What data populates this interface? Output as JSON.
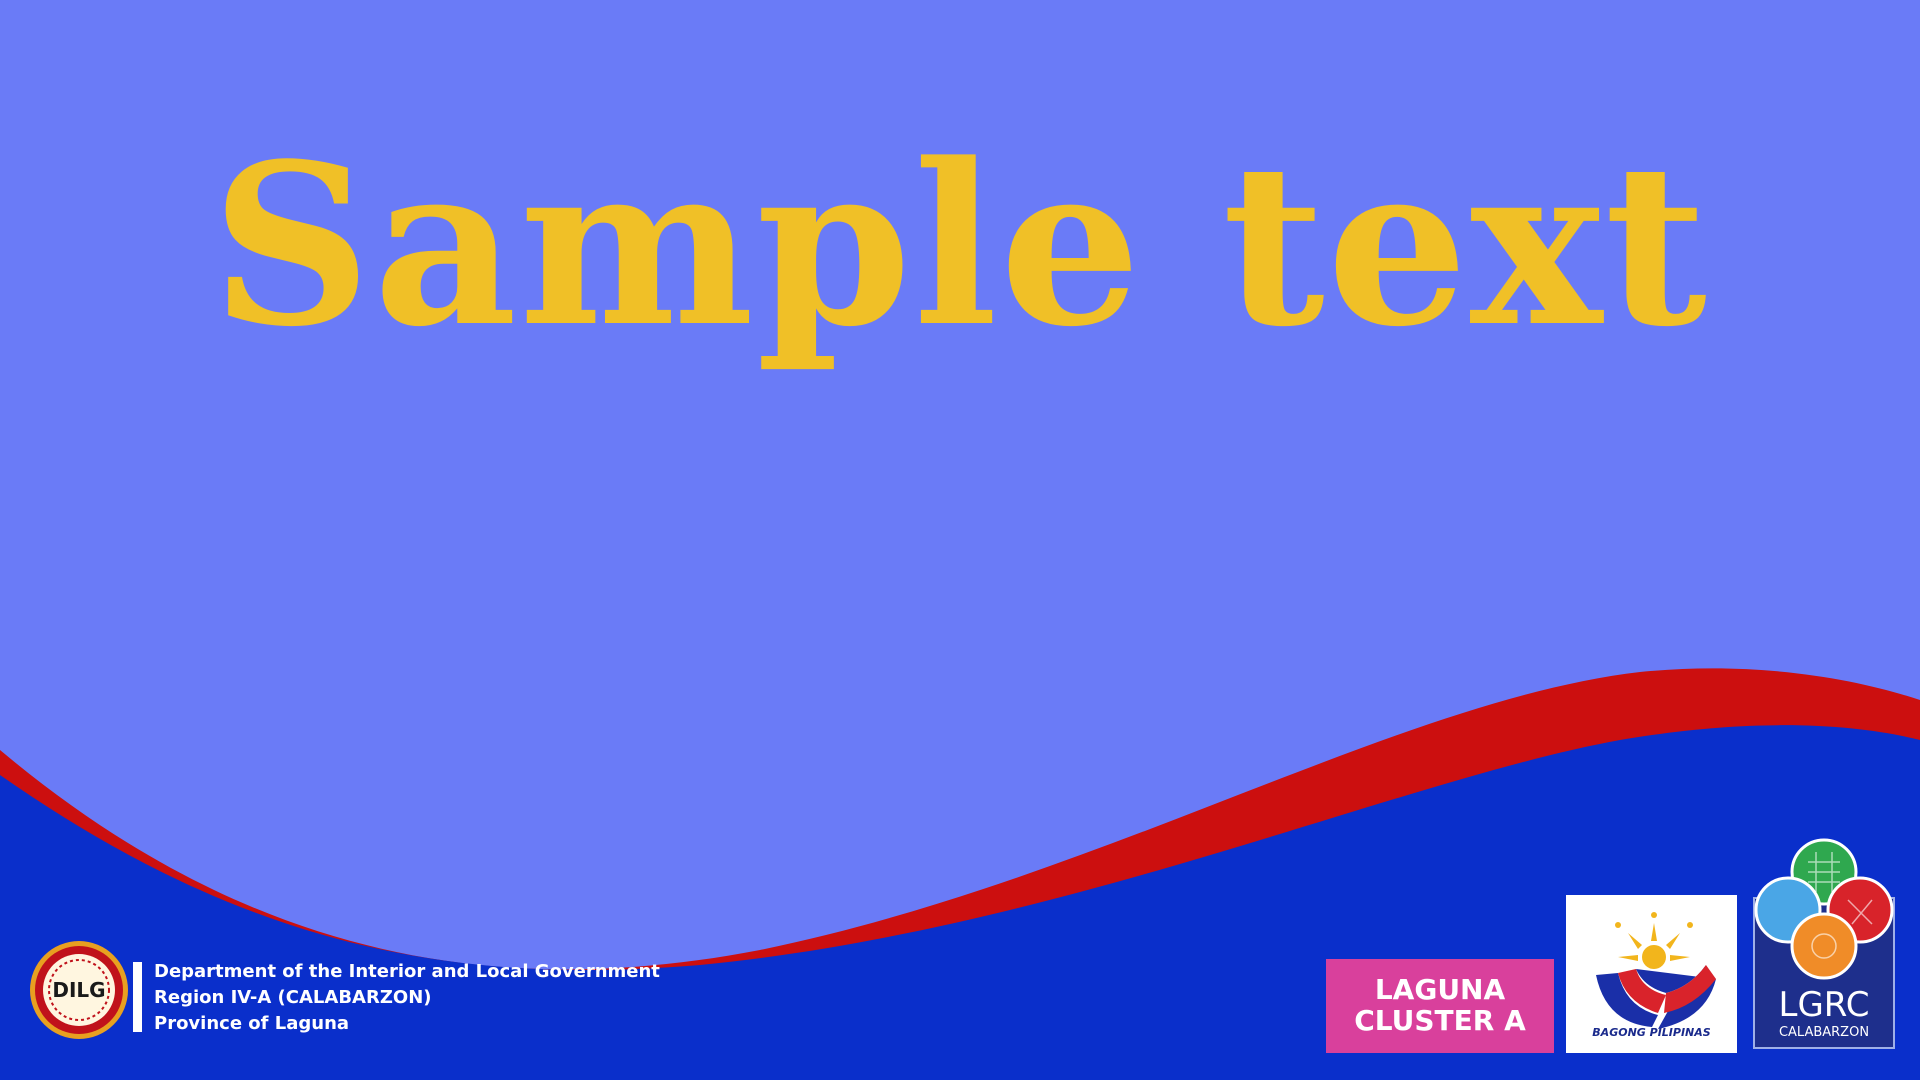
{
  "slide": {
    "title": "Sample text",
    "organization": {
      "seal_text": "DILG",
      "line1": "Department of the Interior and Local Government",
      "line2": "Region IV-A (CALABARZON)",
      "line3": "Province of Laguna"
    },
    "cluster_badge": {
      "line1": "LAGUNA",
      "line2": "CLUSTER A"
    },
    "bagong_pilipinas_text": "BAGONG PILIPINAS",
    "lgrc": {
      "name": "LGRC",
      "region": "CALABARZON"
    }
  },
  "colors": {
    "background": "#6a7bf7",
    "title": "#f0c027",
    "footer_blue": "#0a2fcb",
    "footer_red": "#cc0f0f",
    "cluster_pink": "#d9409c",
    "lgrc_navy": "#1e2f8c"
  },
  "icons": [
    "dilg-seal-icon",
    "bagong-pilipinas-logo-icon",
    "lgrc-logo-icon"
  ]
}
